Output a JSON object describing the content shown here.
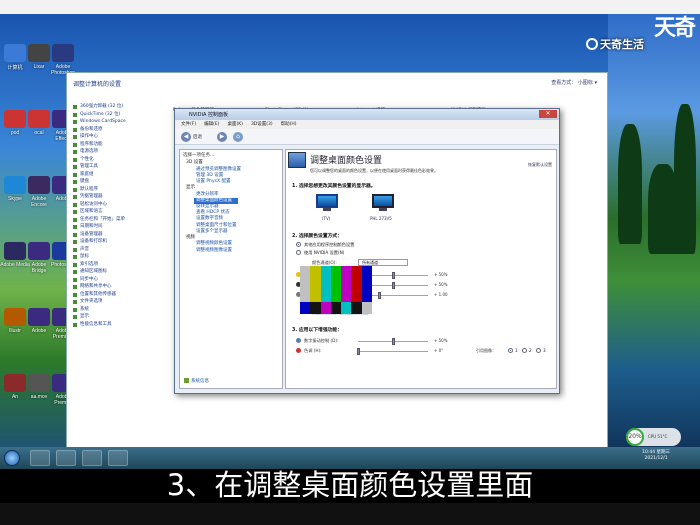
{
  "caption": "3、在调整桌面颜色设置里面",
  "brand": {
    "top_text": "天奇",
    "logo_text": "天奇生活"
  },
  "desktop_icons": [
    {
      "label": "计算机",
      "color": "#3b7ad6"
    },
    {
      "label": "Lixar",
      "color": "#444"
    },
    {
      "label": "Adobe Photoshop",
      "color": "#2a3a80"
    },
    {
      "label": "pod",
      "color": "#c33"
    },
    {
      "label": "ocal",
      "color": "#c33"
    },
    {
      "label": "Adobe Effects",
      "color": "#3a2a80"
    },
    {
      "label": "Skype",
      "color": "#1e88d6"
    },
    {
      "label": "Adobe Encore",
      "color": "#3a2a60"
    },
    {
      "label": "Adobe",
      "color": "#3a2a80"
    },
    {
      "label": "Adobe Media",
      "color": "#2a2a60"
    },
    {
      "label": "Adobe Bridge",
      "color": "#3a2a80"
    },
    {
      "label": "Photoshop",
      "color": "#1a3aa0"
    },
    {
      "label": "Illustr",
      "color": "#b35a00"
    },
    {
      "label": "Adobe",
      "color": "#3a2a80"
    },
    {
      "label": "Adobe Premiere",
      "color": "#3a2a80"
    },
    {
      "label": "An",
      "color": "#8a2a2a"
    },
    {
      "label": "aa.mov",
      "color": "#555"
    },
    {
      "label": "Adobe Premier",
      "color": "#3a2a80"
    }
  ],
  "control_panel": {
    "title": "调整计算机的设置",
    "view_by": "查看方式：  小图标 ▾",
    "links": [
      "360强力卸载 (32 位)",
      "QuickTime (32 位)",
      "Windows CardSpace",
      "备份和还原",
      "操作中心",
      "程序和功能",
      "电源选项",
      "个性化",
      "管理工具",
      "家庭组",
      "键盘",
      "默认程序",
      "凭据管理器",
      "轻松访问中心",
      "区域和语言",
      "任务栏和「开始」菜单",
      "日期和时间",
      "设备管理器",
      "设备和打印机",
      "声音",
      "鼠标",
      "索引选项",
      "通知区域图标",
      "同步中心",
      "网络和共享中心",
      "位置和其他传感器",
      "文件夹选项",
      "系统",
      "显示",
      "性能信息和工具"
    ],
    "top_items": [
      "Fcfocus 颜色管理器",
      "Flash Player (32 位)",
      "Internet 选项",
      "NVIDIA 控制面板"
    ]
  },
  "nvidia": {
    "window_title": "NVIDIA 控制面板",
    "menus": [
      "文件(F)",
      "编辑(E)",
      "桌面(K)",
      "3D设置(3)",
      "帮助(H)"
    ],
    "toolbar": {
      "back": "后退",
      "forward": "",
      "home": ""
    },
    "task_header": "选择一项任务...",
    "tree": [
      {
        "cat": "3D 设置",
        "items": [
          "通过预览调整图像设置",
          "管理 3D 设置",
          "设置 PhysX 配置"
        ]
      },
      {
        "cat": "显示",
        "items": [
          "更改分辨率",
          "调整桌面颜色设置",
          "旋转显示器",
          "查看 HDCP 状态",
          "设置数字音频",
          "调整桌面尺寸和位置",
          "设置多个显示器"
        ]
      },
      {
        "cat": "视频",
        "items": [
          "调整视频颜色设置",
          "调整视频图像设置"
        ]
      }
    ],
    "selected_item": "调整桌面颜色设置",
    "system_info": "系统信息",
    "page_title": "调整桌面颜色设置",
    "restore": "恢复默认设置",
    "description": "您可以调整您的桌面的颜色设置，以便在使用桌面时获得最佳色彩效果。",
    "section1": "1. 选择您想更改其颜色设置的显示器。",
    "monitors": [
      {
        "label": "(TV)",
        "selected": true
      },
      {
        "label": "PHL 273V5",
        "selected": false
      }
    ],
    "section2": "2. 选择颜色设置方式：",
    "radio_options": [
      {
        "label": "其他应用程序控制颜色设置",
        "on": true
      },
      {
        "label": "使用 NVIDIA 设置(N)",
        "on": false
      }
    ],
    "channel_label": "颜色通道(O):",
    "channel_value": "所有通道",
    "settings": [
      {
        "label": "亮度 (B):",
        "value": "+ 50%",
        "level": 0.5
      },
      {
        "label": "对比度 (C):",
        "value": "+ 50%",
        "level": 0.5
      },
      {
        "label": "灰度 (G):",
        "value": "+ 1.00",
        "level": 0.3
      }
    ],
    "reset_note": "恢复所有颜色调整设置到默认值",
    "section3": "3. 应用以下增强功能：",
    "enhancements": [
      {
        "label": "数字振动控制 (D):",
        "value": "+ 50%",
        "level": 0.5
      },
      {
        "label": "色调 (H):",
        "value": "+ 0°",
        "level": 0.0
      }
    ],
    "reference_label": "引用图像：",
    "reference_options": [
      "1",
      "2",
      "3"
    ],
    "test_bar_colors": [
      "#c0c0c0",
      "#c0c000",
      "#00c0c0",
      "#00c000",
      "#c000c0",
      "#c00000",
      "#0000c0"
    ],
    "test_bottom_colors": [
      "#0000c0",
      "#131313",
      "#c000c0",
      "#131313",
      "#00c0c0",
      "#131313",
      "#c0c0c0"
    ]
  },
  "taskbar": {
    "time": "10:44 星期三",
    "date": "2021/12/1"
  },
  "widget": {
    "percent": "20%",
    "text": "CPU 51°C"
  }
}
